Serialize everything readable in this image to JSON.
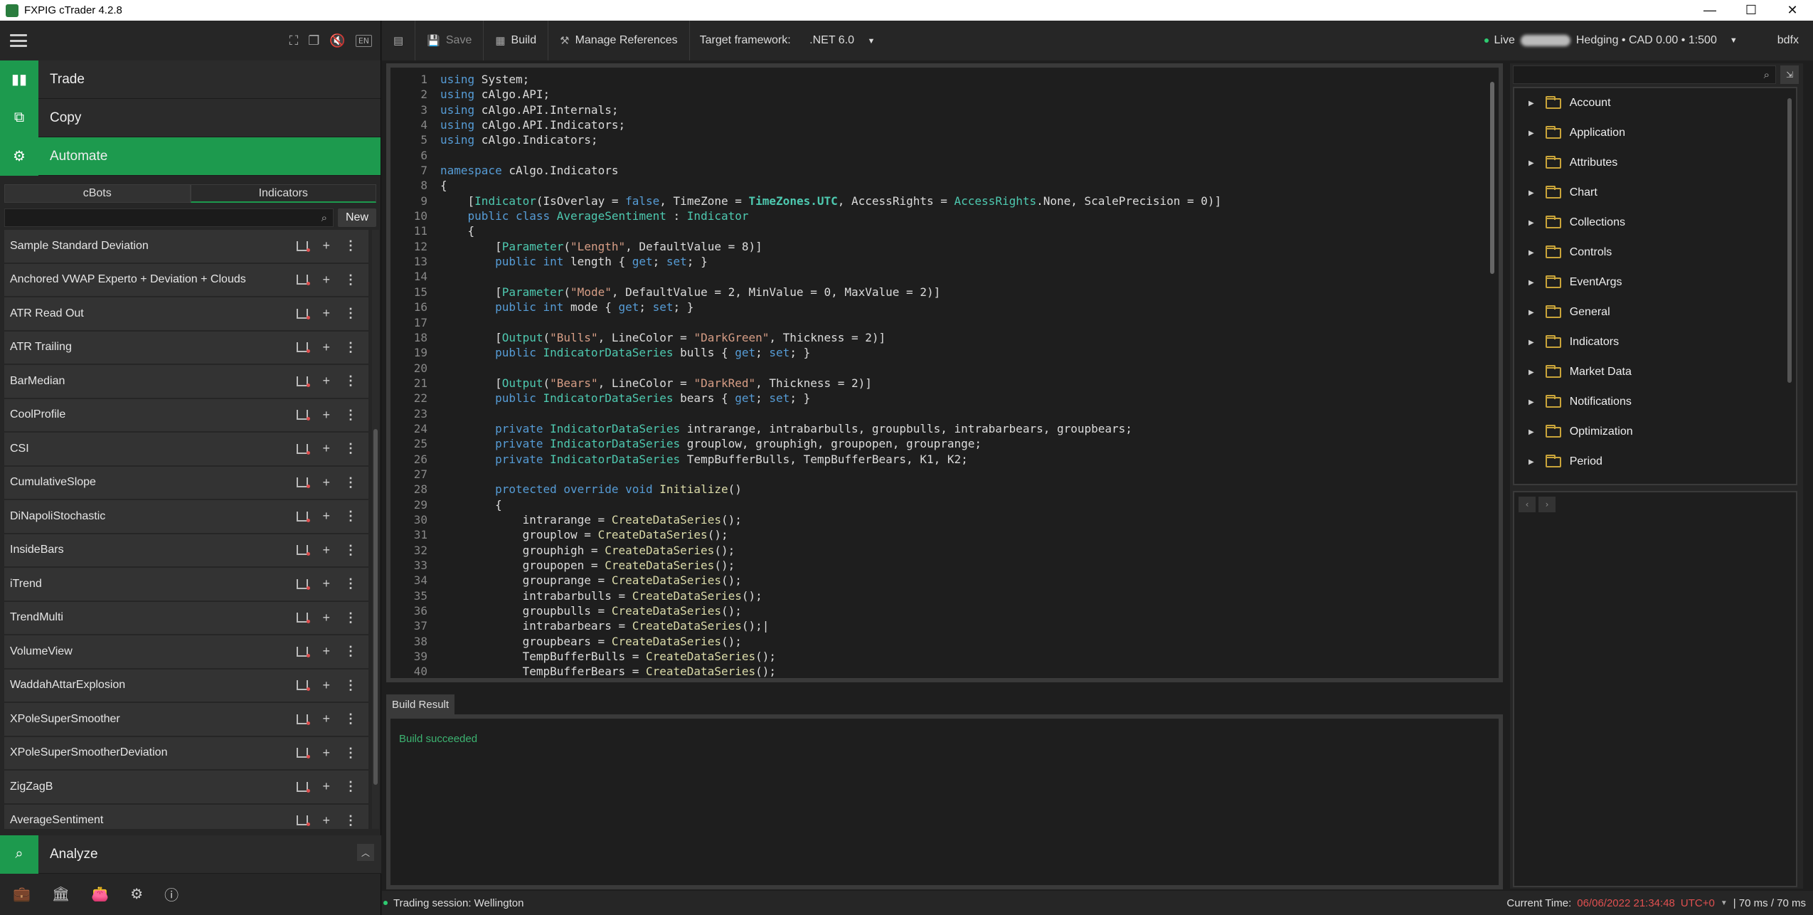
{
  "window": {
    "title": "FXPIG cTrader 4.2.8"
  },
  "window_controls": {
    "minimize": "—",
    "maximize": "☐",
    "close": "✕"
  },
  "left_header": {
    "lang": "EN"
  },
  "nav": {
    "trade": "Trade",
    "copy": "Copy",
    "automate": "Automate",
    "analyze": "Analyze"
  },
  "subtabs": {
    "cbots": "cBots",
    "indicators": "Indicators"
  },
  "search": {
    "new_label": "New"
  },
  "indicators": [
    {
      "name": "Sample Standard Deviation"
    },
    {
      "name": "Anchored VWAP Experto + Deviation + Clouds"
    },
    {
      "name": "ATR Read Out"
    },
    {
      "name": "ATR Trailing"
    },
    {
      "name": "BarMedian"
    },
    {
      "name": "CoolProfile"
    },
    {
      "name": "CSI"
    },
    {
      "name": "CumulativeSlope"
    },
    {
      "name": "DiNapoliStochastic"
    },
    {
      "name": "InsideBars"
    },
    {
      "name": "iTrend"
    },
    {
      "name": "TrendMulti"
    },
    {
      "name": "VolumeView"
    },
    {
      "name": "WaddahAttarExplosion"
    },
    {
      "name": "XPoleSuperSmoother"
    },
    {
      "name": "XPoleSuperSmootherDeviation"
    },
    {
      "name": "ZigZagB"
    },
    {
      "name": "AverageSentiment"
    }
  ],
  "toolbar": {
    "save": "Save",
    "build": "Build",
    "manage_refs": "Manage References",
    "target_label": "Target framework:",
    "target_value": ".NET 6.0"
  },
  "account": {
    "mode": "Live",
    "info": "Hedging • CAD 0.00 • 1:500",
    "user": "bdfx"
  },
  "code_lines": [
    "1",
    "2",
    "3",
    "4",
    "5",
    "6",
    "7",
    "8",
    "9",
    "10",
    "11",
    "12",
    "13",
    "14",
    "15",
    "16",
    "17",
    "18",
    "19",
    "20",
    "21",
    "22",
    "23",
    "24",
    "25",
    "26",
    "27",
    "28",
    "29",
    "30",
    "31",
    "32",
    "33",
    "34",
    "35",
    "36",
    "37",
    "38",
    "39",
    "40"
  ],
  "build": {
    "tab": "Build Result",
    "message": "Build succeeded"
  },
  "tree": [
    {
      "label": "Account"
    },
    {
      "label": "Application"
    },
    {
      "label": "Attributes"
    },
    {
      "label": "Chart"
    },
    {
      "label": "Collections"
    },
    {
      "label": "Controls"
    },
    {
      "label": "EventArgs"
    },
    {
      "label": "General"
    },
    {
      "label": "Indicators"
    },
    {
      "label": "Market Data"
    },
    {
      "label": "Notifications"
    },
    {
      "label": "Optimization"
    },
    {
      "label": "Period"
    }
  ],
  "status": {
    "session": "Trading session: Wellington",
    "time_label": "Current Time:",
    "time_value": "06/06/2022 21:34:48",
    "tz": "UTC+0",
    "latency": "| 70 ms / 70 ms"
  }
}
